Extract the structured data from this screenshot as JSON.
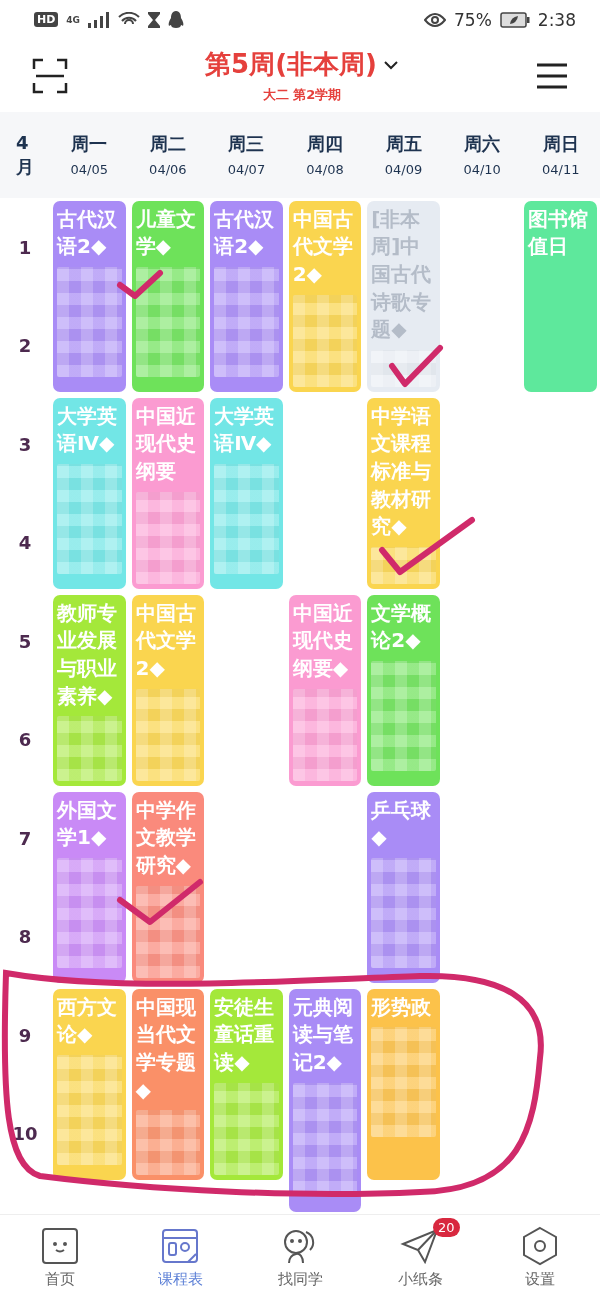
{
  "status_bar": {
    "network_badge": "HD",
    "network_type": "4G",
    "battery": "75%",
    "time": "2:38"
  },
  "header": {
    "title": "第5周(非本周)",
    "subtitle": "大二 第2学期"
  },
  "week_header": {
    "month": "4月",
    "days": [
      {
        "label": "周一",
        "date": "04/05"
      },
      {
        "label": "周二",
        "date": "04/06"
      },
      {
        "label": "周三",
        "date": "04/07"
      },
      {
        "label": "周四",
        "date": "04/08"
      },
      {
        "label": "周五",
        "date": "04/09"
      },
      {
        "label": "周六",
        "date": "04/10"
      },
      {
        "label": "周日",
        "date": "04/11"
      }
    ]
  },
  "periods": [
    "1",
    "2",
    "3",
    "4",
    "5",
    "6",
    "7",
    "8",
    "9",
    "10"
  ],
  "schedule": [
    {
      "slots": [
        {
          "kind": "course",
          "title": "古代汉语2◆",
          "color": "#a98cf6",
          "dimmed": false,
          "redacted": true
        },
        {
          "kind": "course",
          "title": "大学英语Ⅳ◆",
          "color": "#72e6e6",
          "dimmed": false,
          "redacted": true
        },
        {
          "kind": "course",
          "title": "教师专业发展与职业素养◆",
          "color": "#a4e83a",
          "dimmed": false,
          "redacted": true
        },
        {
          "kind": "course",
          "title": "外国文学1◆",
          "color": "#c98af6",
          "dimmed": false,
          "redacted": true
        },
        {
          "kind": "course",
          "title": "西方文论◆",
          "color": "#fad54f",
          "dimmed": false,
          "redacted": true
        }
      ]
    },
    {
      "slots": [
        {
          "kind": "course",
          "title": "儿童文学◆",
          "color": "#6ee25a",
          "dimmed": false,
          "redacted": true
        },
        {
          "kind": "course",
          "title": "中国近现代史纲要",
          "color": "#fb9bd1",
          "dimmed": false,
          "redacted": true
        },
        {
          "kind": "course",
          "title": "中国古代文学2◆",
          "color": "#fad54f",
          "dimmed": false,
          "redacted": true
        },
        {
          "kind": "course",
          "title": "中学作文教学研究◆",
          "color": "#fa8a7c",
          "dimmed": false,
          "redacted": true
        },
        {
          "kind": "course",
          "title": "中国现当代文学专题◆",
          "color": "#fa9068",
          "dimmed": false,
          "redacted": true
        }
      ]
    },
    {
      "slots": [
        {
          "kind": "course",
          "title": "古代汉语2◆",
          "color": "#a98cf6",
          "dimmed": false,
          "redacted": true
        },
        {
          "kind": "course",
          "title": "大学英语Ⅳ◆",
          "color": "#72e6e6",
          "dimmed": false,
          "redacted": true
        },
        {
          "kind": "empty"
        },
        {
          "kind": "empty"
        },
        {
          "kind": "course",
          "title": "安徒生童话重读◆",
          "color": "#a4e83a",
          "dimmed": false,
          "redacted": true
        }
      ]
    },
    {
      "slots": [
        {
          "kind": "course",
          "title": "中国古代文学2◆",
          "color": "#fad54f",
          "dimmed": false,
          "redacted": true
        },
        {
          "kind": "empty"
        },
        {
          "kind": "course",
          "title": "中国近现代史纲要◆",
          "color": "#fb9bd1",
          "dimmed": false,
          "redacted": true
        },
        {
          "kind": "empty"
        },
        {
          "kind": "extended",
          "title": "元典阅读与笔记2◆",
          "color": "#a98cf6",
          "dimmed": false,
          "redacted": true
        }
      ]
    },
    {
      "slots": [
        {
          "kind": "course",
          "title": "[非本周]中国古代诗歌专题◆",
          "color": "#e6ebf2",
          "dimmed": true,
          "redacted": true
        },
        {
          "kind": "course",
          "title": "中学语文课程标准与教材研究◆",
          "color": "#fad54f",
          "dimmed": false,
          "redacted": true
        },
        {
          "kind": "course",
          "title": "文学概论2◆",
          "color": "#6ee25a",
          "dimmed": false,
          "redacted": true
        },
        {
          "kind": "course",
          "title": "乒乓球◆",
          "color": "#a98cf6",
          "dimmed": false,
          "redacted": true
        },
        {
          "kind": "course",
          "title": "形势政",
          "color": "#fcc24a",
          "dimmed": false,
          "redacted": true
        }
      ]
    },
    {
      "slots": [
        {
          "kind": "empty"
        },
        {
          "kind": "empty"
        },
        {
          "kind": "empty"
        },
        {
          "kind": "empty"
        },
        {
          "kind": "empty"
        }
      ]
    },
    {
      "slots": [
        {
          "kind": "course",
          "title": "图书馆值日",
          "color": "#5ee89c",
          "dimmed": false,
          "redacted": false
        },
        {
          "kind": "empty"
        },
        {
          "kind": "empty"
        },
        {
          "kind": "empty"
        },
        {
          "kind": "empty"
        }
      ]
    }
  ],
  "tab_bar": [
    {
      "kind": "home",
      "label": "首页",
      "selected": false
    },
    {
      "kind": "schedule",
      "label": "课程表",
      "selected": true
    },
    {
      "kind": "friends",
      "label": "找同学",
      "selected": false
    },
    {
      "kind": "notes",
      "label": "小纸条",
      "selected": false,
      "badge": "20"
    },
    {
      "kind": "settings",
      "label": "设置",
      "selected": false
    }
  ]
}
